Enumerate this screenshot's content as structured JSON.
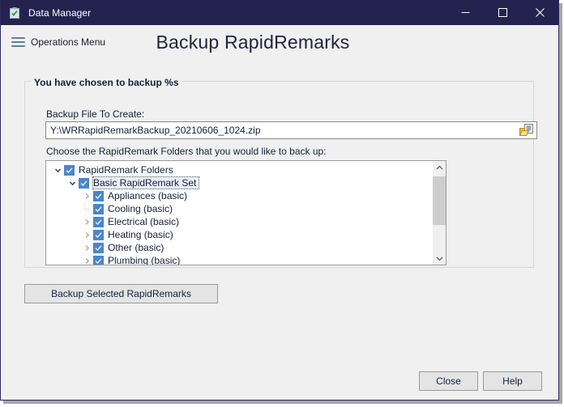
{
  "window": {
    "title": "Data Manager",
    "icon": "clipboard-check-icon",
    "controls": {
      "minimize": "minimize-icon",
      "maximize": "maximize-icon",
      "close": "close-icon"
    },
    "titlebar_color": "#242350"
  },
  "header": {
    "menu_label": "Operations Menu",
    "menu_icon": "hamburger-icon",
    "page_title": "Backup RapidRemarks"
  },
  "group": {
    "legend": "You have chosen to backup %s"
  },
  "backup_file": {
    "label": "Backup File To Create:",
    "value": "Y:\\WRRapidRemarkBackup_20210606_1024.zip",
    "placeholder": "Backup file path",
    "browse_icon": "folder-browse-icon"
  },
  "folders": {
    "label": "Choose the RapidRemark Folders that you would like to back up:",
    "tree": [
      {
        "label": "RapidRemark Folders",
        "indent": 0,
        "expander": "chevron-down",
        "checked": true,
        "selected": false
      },
      {
        "label": "Basic RapidRemark Set",
        "indent": 1,
        "expander": "chevron-down",
        "checked": true,
        "selected": true
      },
      {
        "label": "Appliances (basic)",
        "indent": 2,
        "expander": "chevron-right",
        "checked": true,
        "selected": false
      },
      {
        "label": "Cooling (basic)",
        "indent": 2,
        "expander": "dotted-line",
        "checked": true,
        "selected": false
      },
      {
        "label": "Electrical (basic)",
        "indent": 2,
        "expander": "chevron-right",
        "checked": true,
        "selected": false
      },
      {
        "label": "Heating (basic)",
        "indent": 2,
        "expander": "chevron-right",
        "checked": true,
        "selected": false
      },
      {
        "label": "Other (basic)",
        "indent": 2,
        "expander": "chevron-right",
        "checked": true,
        "selected": false
      },
      {
        "label": "Plumbing (basic)",
        "indent": 2,
        "expander": "chevron-right",
        "checked": true,
        "selected": false
      }
    ],
    "scrollbar": {
      "up_icon": "chevron-up-icon",
      "down_icon": "chevron-down-icon",
      "thumb_fraction": 0.62
    },
    "checkbox_color": "#4a86c8"
  },
  "buttons": {
    "backup": "Backup Selected RapidRemarks",
    "close": "Close",
    "help": "Help"
  }
}
